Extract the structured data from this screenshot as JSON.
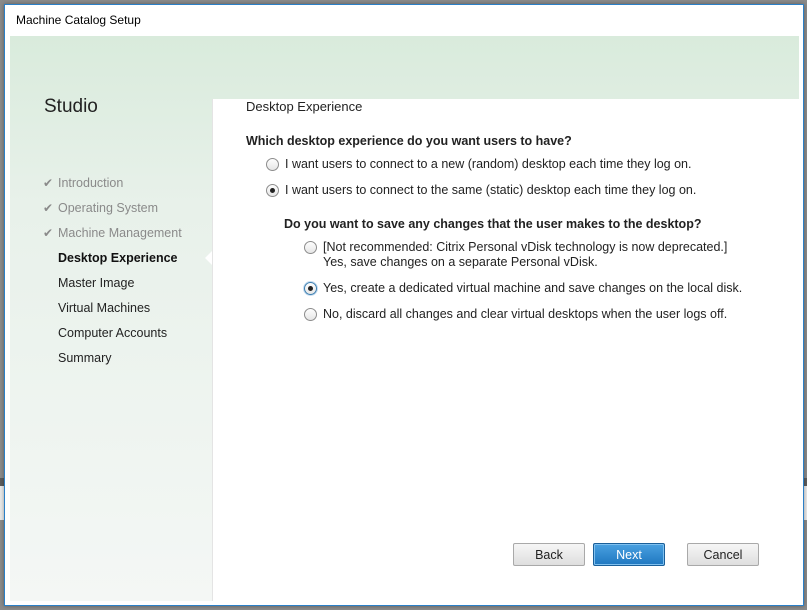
{
  "window": {
    "title": "Machine Catalog Setup"
  },
  "sidebar": {
    "title": "Studio",
    "items": [
      {
        "label": "Introduction",
        "state": "done"
      },
      {
        "label": "Operating System",
        "state": "done"
      },
      {
        "label": "Machine Management",
        "state": "done"
      },
      {
        "label": "Desktop Experience",
        "state": "active"
      },
      {
        "label": "Master Image",
        "state": "pending"
      },
      {
        "label": "Virtual Machines",
        "state": "pending"
      },
      {
        "label": "Computer Accounts",
        "state": "pending"
      },
      {
        "label": "Summary",
        "state": "pending"
      }
    ]
  },
  "page": {
    "section_title": "Desktop Experience",
    "q1": {
      "text": "Which desktop experience do you want users to have?",
      "options": [
        {
          "label": "I want users to connect to a new (random) desktop each time they log on.",
          "checked": false
        },
        {
          "label": "I want users to connect to the same (static) desktop each time they log on.",
          "checked": true
        }
      ]
    },
    "q2": {
      "text": "Do you want to save any changes that the user makes to the desktop?",
      "options": [
        {
          "line1": "[Not recommended: Citrix Personal vDisk technology is now deprecated.]",
          "line2": "Yes, save changes on a separate Personal vDisk.",
          "checked": false
        },
        {
          "label": "Yes, create a dedicated virtual machine and save changes on the local disk.",
          "checked": true
        },
        {
          "label": "No, discard all changes and clear virtual desktops when the user logs off.",
          "checked": false
        }
      ]
    }
  },
  "buttons": {
    "back": "Back",
    "next": "Next",
    "cancel": "Cancel"
  },
  "colors": {
    "accent": "#1f77c0",
    "sidebar_bg": "#d9ebdc"
  }
}
